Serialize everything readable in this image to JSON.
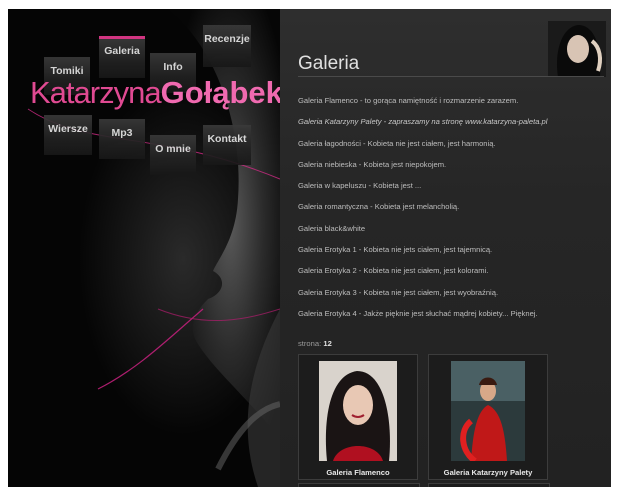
{
  "site": {
    "logo_first": "Katarzyna",
    "logo_last": "Gołąbek"
  },
  "nav": {
    "tomiki": "Tomiki",
    "galeria": "Galeria",
    "info": "Info",
    "recenzje": "Recenzje",
    "wiersze": "Wiersze",
    "mp3": "Mp3",
    "o_mnie": "O mnie",
    "kontakt": "Kontakt"
  },
  "main": {
    "title": "Galeria",
    "galleries": [
      "Galeria Flamenco - to gorąca namiętność i rozmarzenie zarazem.",
      "Galeria Katarzyny Palety - zapraszamy na stronę www.katarzyna-paleta.pl",
      "Galeria łagodności - Kobieta nie jest ciałem, jest harmonią.",
      "Galeria niebieska - Kobieta jest niepokojem.",
      "Galeria w kapeluszu - Kobieta jest ...",
      "Galeria romantyczna - Kobieta jest melancholią.",
      "Galeria black&white",
      "Galeria Erotyka 1 - Kobieta nie jets ciałem, jest tajemnicą.",
      "Galeria Erotyka 2 - Kobieta nie jest ciałem, jest kolorami.",
      "Galeria Erotyka 3 - Kobieta nie jest ciałem, jest wyobraźnią.",
      "Galeria Erotyka 4 - Jakże pięknie jest słuchać mądrej kobiety... Pięknej."
    ],
    "pager_label": "strona:",
    "pager_page": "12",
    "thumbs": [
      {
        "caption": "Galeria Flamenco"
      },
      {
        "caption": "Galeria Katarzyny Palety"
      }
    ]
  },
  "colors": {
    "accent": "#e33a8c",
    "background": "#000000",
    "panel": "#262626"
  }
}
